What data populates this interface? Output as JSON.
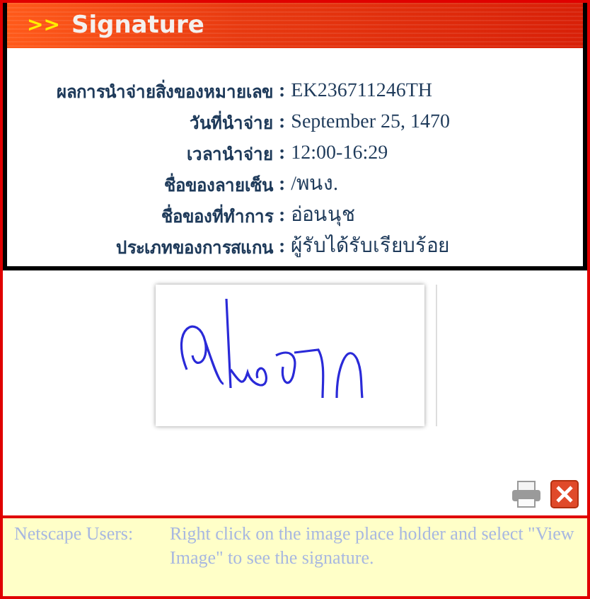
{
  "header": {
    "arrows": ">>",
    "title": "Signature"
  },
  "details": [
    {
      "label": "ผลการนำจ่ายสิ่งของหมายเลข",
      "value": "EK236711246TH"
    },
    {
      "label": "วันที่นำจ่าย",
      "value": "September 25, 1470"
    },
    {
      "label": "เวลานำจ่าย",
      "value": "12:00-16:29"
    },
    {
      "label": "ชื่อของลายเซ็น",
      "value": "/พนง."
    },
    {
      "label": "ชื่อของที่ทำการ",
      "value": "อ่อนนุช"
    },
    {
      "label": "ประเภทของการสแกน",
      "value": "ผู้รับได้รับเรียบร้อย"
    }
  ],
  "separator": ":",
  "note": {
    "label": "Netscape Users:",
    "text": "Right click on the image place holder and select \"View Image\" to see the signature."
  }
}
